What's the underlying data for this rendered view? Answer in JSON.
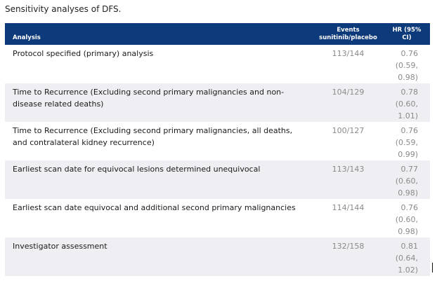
{
  "caption": "Sensitivity analyses of DFS.",
  "table": {
    "headers": {
      "analysis": "Analysis",
      "events_line1": "Events",
      "events_line2": "sunitinib/placebo",
      "hr_line1": "HR (95%",
      "hr_line2": "CI)"
    },
    "rows": [
      {
        "analysis_line1": "Protocol specified (primary) analysis",
        "analysis_line2": "",
        "events": "113/144",
        "hr_line1": "0.76",
        "hr_line2": "(0.59,",
        "hr_line3": "0.98)"
      },
      {
        "analysis_line1": "Time to Recurrence (Excluding second primary malignancies and non-",
        "analysis_line2": "disease related deaths)",
        "events": "104/129",
        "hr_line1": "0.78",
        "hr_line2": "(0.60,",
        "hr_line3": "1.01)"
      },
      {
        "analysis_line1": "Time to Recurrence (Excluding second primary malignancies, all deaths,",
        "analysis_line2": "and contralateral kidney recurrence)",
        "events": "100/127",
        "hr_line1": "0.76",
        "hr_line2": "(0.59,",
        "hr_line3": "0.99)"
      },
      {
        "analysis_line1": "Earliest scan date for equivocal lesions determined unequivocal",
        "analysis_line2": "",
        "events": "113/143",
        "hr_line1": "0.77",
        "hr_line2": "(0.60,",
        "hr_line3": "0.98)"
      },
      {
        "analysis_line1": "Earliest scan date equivocal and additional second primary malignancies",
        "analysis_line2": "",
        "events": "114/144",
        "hr_line1": "0.76",
        "hr_line2": "(0.60,",
        "hr_line3": "0.98)"
      },
      {
        "analysis_line1": "Investigator assessment",
        "analysis_line2": "",
        "events": "132/158",
        "hr_line1": "0.81",
        "hr_line2": "(0.64,",
        "hr_line3": "1.02)"
      }
    ]
  }
}
